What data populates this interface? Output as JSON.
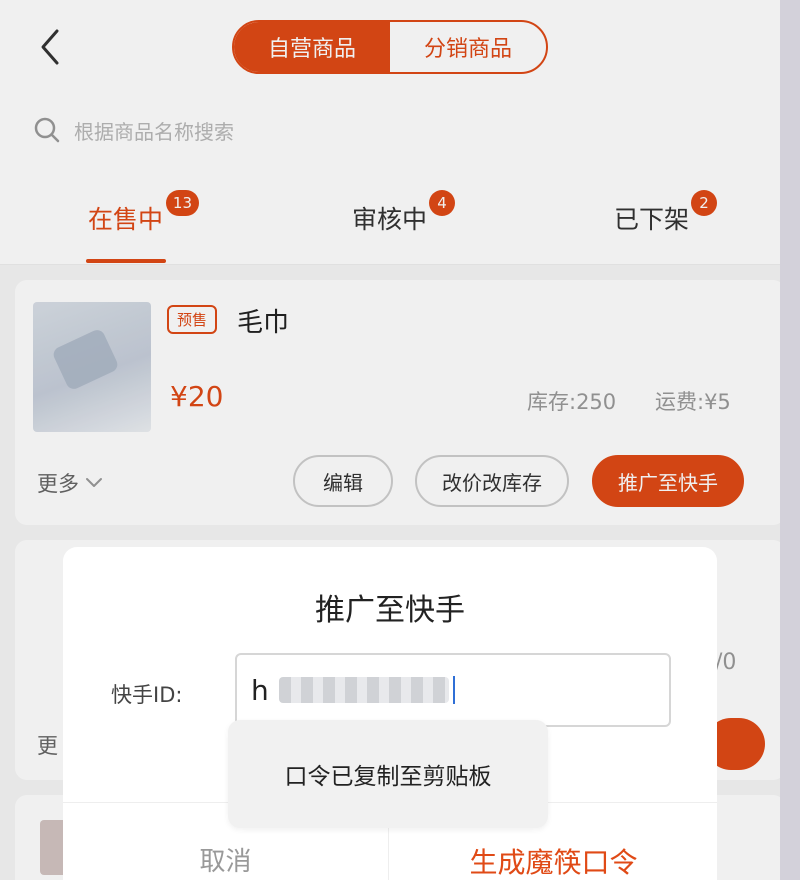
{
  "header": {
    "back_icon": "chevron-left-icon",
    "segments": [
      {
        "label": "自营商品",
        "active": true
      },
      {
        "label": "分销商品",
        "active": false
      }
    ]
  },
  "search": {
    "placeholder": "根据商品名称搜索",
    "icon": "search-icon"
  },
  "tabs": [
    {
      "label": "在售中",
      "badge": "13",
      "active": true
    },
    {
      "label": "审核中",
      "badge": "4",
      "active": false
    },
    {
      "label": "已下架",
      "badge": "2",
      "active": false
    }
  ],
  "product": {
    "tag": "预售",
    "name": "毛巾",
    "price": "¥20",
    "stock": "库存:250",
    "shipping": "运费:¥5",
    "more": "更多",
    "buttons": {
      "edit": "编辑",
      "price_stock": "改价改库存",
      "promote": "推广至快手"
    }
  },
  "background_peek": {
    "right_text": "/0",
    "left_text": "更"
  },
  "dialog": {
    "title": "推广至快手",
    "field_label": "快手ID:",
    "field_value": "h",
    "cancel": "取消",
    "confirm": "生成魔筷口令"
  },
  "toast": {
    "text": "口令已复制至剪贴板"
  },
  "colors": {
    "accent": "#e04a16",
    "muted": "#999999"
  }
}
